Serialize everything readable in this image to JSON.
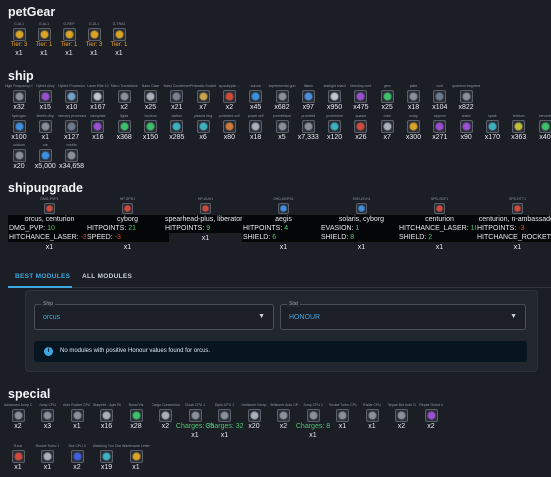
{
  "petgear": {
    "heading": "petGear",
    "items": [
      {
        "label": "G-AL1",
        "tier": "Tier: 3",
        "qty": "x1",
        "icon": "pet-gear-icon",
        "color": "#d8a426"
      },
      {
        "label": "G-AL1",
        "tier": "Tier: 1",
        "qty": "x1",
        "icon": "pet-gear-icon",
        "color": "#d8a426"
      },
      {
        "label": "G-REP",
        "tier": "Tier: 1",
        "qty": "x1",
        "icon": "pet-gear-icon",
        "color": "#d8a426"
      },
      {
        "label": "G-DL1",
        "tier": "Tier: 3",
        "qty": "x1",
        "icon": "pet-gear-icon",
        "color": "#d8a426"
      },
      {
        "label": "G-TRA1",
        "tier": "Tier: 1",
        "qty": "x1",
        "icon": "pet-gear-icon",
        "color": "#d8a426"
      }
    ]
  },
  "ship": {
    "heading": "ship",
    "items": [
      {
        "label": "High Frequency Cable",
        "qty": "x32",
        "icon": "cable-icon",
        "color": "#8a8f99"
      },
      {
        "label": "Hybrid Alloy",
        "qty": "x15",
        "icon": "alloy-icon",
        "color": "#9b4fd1"
      },
      {
        "label": "Hybrid Processor",
        "qty": "x10",
        "icon": "processor-icon",
        "color": "#6fa0c8"
      },
      {
        "label": "Laser Elite 10",
        "qty": "x167",
        "icon": "laser-icon",
        "color": "#c0c4cc"
      },
      {
        "label": "Micro Transistors",
        "qty": "x2",
        "icon": "transistor-icon",
        "color": "#8a8f99"
      },
      {
        "label": "Nano Case",
        "qty": "x25",
        "icon": "case-icon",
        "color": "#aab0ba"
      },
      {
        "label": "Nano Condenser",
        "qty": "x21",
        "icon": "condenser-icon",
        "color": "#7a8090"
      },
      {
        "label": "Prismatic Socket",
        "qty": "x7",
        "icon": "socket-icon",
        "color": "#c7a34a"
      },
      {
        "label": "apocalyptic ...",
        "qty": "x2",
        "icon": "apocalyptic-icon",
        "color": "#d04a3a"
      },
      {
        "label": "aurora",
        "qty": "x45",
        "icon": "aurora-icon",
        "color": "#3f8fe0"
      },
      {
        "label": "experimental gun",
        "qty": "x682",
        "icon": "gun-icon",
        "color": "#8a8f99"
      },
      {
        "label": "flakes",
        "qty": "x97",
        "icon": "flakes-icon",
        "color": "#4a8fe0"
      },
      {
        "label": "starlight shard",
        "qty": "x950",
        "icon": "shard-icon",
        "color": "#c0c4cc"
      },
      {
        "label": "bleeding core",
        "qty": "x475",
        "icon": "core-icon",
        "color": "#9b4fd1"
      },
      {
        "label": "gem",
        "qty": "x25",
        "icon": "gem-icon",
        "color": "#3fc06a"
      },
      {
        "label": "plate",
        "qty": "x18",
        "icon": "plate-icon",
        "color": "#8a8f99"
      },
      {
        "label": "core",
        "qty": "x104",
        "icon": "core-icon",
        "color": "#6f7a8a"
      },
      {
        "label": "quantum fragment",
        "qty": "x822",
        "icon": "fragment-icon",
        "color": "#8a8f99"
      },
      {
        "label": "hydrogen",
        "qty": "x100",
        "icon": "hydrogen-icon",
        "color": "#3f8fe0"
      },
      {
        "label": "kinetic chip",
        "qty": "x1",
        "icon": "chip-icon",
        "color": "#8a8f99"
      },
      {
        "label": "memory processor",
        "qty": "x127",
        "icon": "memory-icon",
        "color": "#6f7a8a"
      },
      {
        "label": "nanoplate",
        "qty": "x16",
        "icon": "nanoplate-icon",
        "color": "#9b4fd1"
      },
      {
        "label": "lights",
        "qty": "x368",
        "icon": "lights-icon",
        "color": "#3fc06a"
      },
      {
        "label": "nucleus",
        "qty": "x150",
        "icon": "nucleus-icon",
        "color": "#3fc06a"
      },
      {
        "label": "carbon",
        "qty": "x285",
        "icon": "carbon-icon",
        "color": "#3fb0c0"
      },
      {
        "label": "plasma ring",
        "qty": "x6",
        "icon": "ring-icon",
        "color": "#3fb0c0"
      },
      {
        "label": "polarized cell",
        "qty": "x80",
        "icon": "cell-icon",
        "color": "#d07a3a"
      },
      {
        "label": "power cell",
        "qty": "x18",
        "icon": "power-cell-icon",
        "color": "#aab0ba"
      },
      {
        "label": "promethium",
        "qty": "x5",
        "icon": "promethium-icon",
        "color": "#8a8f99"
      },
      {
        "label": "prometid",
        "qty": "x7,333",
        "icon": "prometid-icon",
        "color": "#8a8f99"
      },
      {
        "label": "promerium",
        "qty": "x120",
        "icon": "promerium-icon",
        "color": "#3fb0c0"
      },
      {
        "label": "quasar",
        "qty": "x26",
        "icon": "quasar-icon",
        "color": "#d04a3a"
      },
      {
        "label": "rotor",
        "qty": "x7",
        "icon": "rotor-icon",
        "color": "#aab0ba"
      },
      {
        "label": "scrap",
        "qty": "x300",
        "icon": "scrap-icon",
        "color": "#d8a426"
      },
      {
        "label": "seprom",
        "qty": "x271",
        "icon": "seprom-icon",
        "color": "#9b4fd1"
      },
      {
        "label": "shard",
        "qty": "x90",
        "icon": "shard-icon",
        "color": "#9b4fd1"
      },
      {
        "label": "spark",
        "qty": "x170",
        "icon": "spark-icon",
        "color": "#3fb0c0"
      },
      {
        "label": "terbium",
        "qty": "x363",
        "icon": "terbium-icon",
        "color": "#c0c03a"
      },
      {
        "label": "xenomit",
        "qty": "x40",
        "icon": "xenomit-icon",
        "color": "#3fc06a"
      },
      {
        "label": "uridium",
        "qty": "x20",
        "icon": "uridium-icon",
        "color": "#8a8f99"
      },
      {
        "label": "ore",
        "qty": "x5,000",
        "icon": "ore-icon",
        "color": "#3f8fe0"
      },
      {
        "label": "credits",
        "qty": "x34,658",
        "icon": "credits-icon",
        "color": "#8a8f99"
      }
    ]
  },
  "shipupgrade": {
    "heading": "shipupgrade",
    "cards": [
      {
        "label": "DMG-PVP1",
        "title": "orcus, centurion",
        "icon": "upgrade-icon",
        "color": "#d04a3a",
        "qty": "x1",
        "stats": [
          {
            "name": "DMG_PVP:",
            "value": "10",
            "sign": "pos"
          },
          {
            "name": "HITCHANCE_LASER:",
            "value": "-3",
            "sign": "neg"
          }
        ]
      },
      {
        "label": "HP-SPD1",
        "title": "cyborg",
        "icon": "upgrade-icon",
        "color": "#d04a3a",
        "qty": "x1",
        "stats": [
          {
            "name": "HITPOINTS:",
            "value": "21",
            "sign": "pos"
          },
          {
            "name": "SPEED:",
            "value": "-3",
            "sign": "neg"
          }
        ]
      },
      {
        "label": "HP-AUX1",
        "title": "spearhead-plus, liberator-plus",
        "icon": "upgrade-icon",
        "color": "#d04a3a",
        "qty": "x1",
        "stats": [
          {
            "name": "HITPOINTS:",
            "value": "9",
            "sign": "pos"
          }
        ]
      },
      {
        "label": "SHD-HDPS1",
        "title": "aegis",
        "icon": "upgrade-icon",
        "color": "#3f8fe0",
        "qty": "x1",
        "stats": [
          {
            "name": "HITPOINTS:",
            "value": "4",
            "sign": "pos"
          },
          {
            "name": "SHIELD:",
            "value": "6",
            "sign": "pos"
          }
        ]
      },
      {
        "label": "SHD-EDH1",
        "title": "solaris, cyborg",
        "icon": "upgrade-icon",
        "color": "#3f8fe0",
        "qty": "x1",
        "stats": [
          {
            "name": "EVASION:",
            "value": "1",
            "sign": "pos"
          },
          {
            "name": "SHIELD:",
            "value": "8",
            "sign": "pos"
          }
        ]
      },
      {
        "label": "SPD-SDF1",
        "title": "centurion",
        "icon": "upgrade-icon",
        "color": "#d04a3a",
        "qty": "x1",
        "stats": [
          {
            "name": "HITCHANCE_LASER:",
            "value": "16",
            "sign": "pos"
          },
          {
            "name": "SHIELD:",
            "value": "2",
            "sign": "pos"
          }
        ]
      },
      {
        "label": "SPD-RTT1",
        "title": "centurion, n-ambassador",
        "icon": "upgrade-icon",
        "color": "#d04a3a",
        "qty": "x1",
        "stats": [
          {
            "name": "HITPOINTS:",
            "value": "-3",
            "sign": "neg"
          },
          {
            "name": "HITCHANCE_ROCKET:",
            "value": "12",
            "sign": "pos"
          }
        ]
      }
    ]
  },
  "tabs": [
    {
      "label": "BEST MODULES",
      "active": true
    },
    {
      "label": "ALL MODULES",
      "active": false
    }
  ],
  "filters": {
    "ship_label": "Ship",
    "ship_value": "orcus",
    "stat_label": "Stat",
    "stat_value": "HONOUR"
  },
  "info": {
    "icon": "info-icon",
    "message": "No modules with positive Honour values found for orcus."
  },
  "special": {
    "heading": "special",
    "items": [
      {
        "label": "Advanced Jump CPU 1",
        "qty": "x2",
        "icon": "cpu-icon",
        "color": "#8a8f99",
        "charges": ""
      },
      {
        "label": "Jump CPU",
        "qty": "x3",
        "icon": "cpu-icon",
        "color": "#8a8f99",
        "charges": ""
      },
      {
        "label": "Auto Rocket CPU 1",
        "qty": "x1",
        "icon": "cpu-icon",
        "color": "#8a8f99",
        "charges": ""
      },
      {
        "label": "Blueprint - Apis Pilot",
        "qty": "x16",
        "icon": "blueprint-icon",
        "color": "#aab0ba",
        "charges": ""
      },
      {
        "label": "Boost Vis",
        "qty": "x28",
        "icon": "boost-icon",
        "color": "#3fc06a",
        "charges": ""
      },
      {
        "label": "Cargo Conversion",
        "qty": "x2",
        "icon": "cargo-icon",
        "color": "#aab0ba",
        "charges": ""
      },
      {
        "label": "Cloak CPU 1",
        "qty": "x1",
        "icon": "cpu-icon",
        "color": "#8a8f99",
        "charges": "Charges: 35"
      },
      {
        "label": "Diplo CPU 1",
        "qty": "x1",
        "icon": "cpu-icon",
        "color": "#8a8f99",
        "charges": "Charges: 32"
      },
      {
        "label": "Hellstorm Scrap",
        "qty": "x20",
        "icon": "scrap-icon",
        "color": "#aab0ba",
        "charges": ""
      },
      {
        "label": "Hellstorm Auto CPU 1",
        "qty": "x2",
        "icon": "cpu-icon",
        "color": "#8a8f99",
        "charges": ""
      },
      {
        "label": "Jump CPU 1",
        "qty": "x1",
        "icon": "cpu-icon",
        "color": "#8a8f99",
        "charges": "Charges: 8"
      },
      {
        "label": "Rocket Turbo CPU 1",
        "qty": "x1",
        "icon": "cpu-icon",
        "color": "#8a8f99",
        "charges": ""
      },
      {
        "label": "Radar CPU",
        "qty": "x1",
        "icon": "radar-icon",
        "color": "#8a8f99",
        "charges": ""
      },
      {
        "label": "Repair Bot Auto CPU",
        "qty": "x2",
        "icon": "cpu-icon",
        "color": "#8a8f99",
        "charges": ""
      },
      {
        "label": "Repair Robot 4",
        "qty": "x2",
        "icon": "robot-icon",
        "color": "#9b4fd1",
        "charges": ""
      },
      {
        "label": "R-bar",
        "qty": "x1",
        "icon": "rbar-icon",
        "color": "#d04a3a",
        "charges": ""
      },
      {
        "label": "Rocket Turbo 1",
        "qty": "x1",
        "icon": "rocket-icon",
        "color": "#aab0ba",
        "charges": ""
      },
      {
        "label": "Slot CPU 4",
        "qty": "x2",
        "icon": "slot-icon",
        "color": "#3f5fe0",
        "charges": ""
      },
      {
        "label": "Watching You Clamp",
        "qty": "x19",
        "icon": "clamp-icon",
        "color": "#3fb0c0",
        "charges": ""
      },
      {
        "label": "Warehouse Letter",
        "qty": "x1",
        "icon": "letter-icon",
        "color": "#d8a426",
        "charges": ""
      }
    ]
  }
}
